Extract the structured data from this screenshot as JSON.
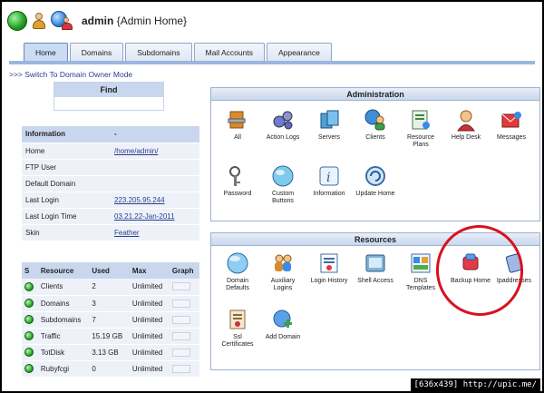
{
  "header": {
    "user": "admin",
    "context": "{Admin Home}"
  },
  "tabs": [
    {
      "label": "Home",
      "active": true
    },
    {
      "label": "Domains",
      "active": false
    },
    {
      "label": "Subdomains",
      "active": false
    },
    {
      "label": "Mail Accounts",
      "active": false
    },
    {
      "label": "Appearance",
      "active": false
    }
  ],
  "switch_link": ">>> Switch To Domain Owner Mode",
  "find": {
    "title": "Find",
    "value": ""
  },
  "information": {
    "header": "Information",
    "header_value": "-",
    "rows": [
      {
        "label": "Home",
        "value": "/home/admin/"
      },
      {
        "label": "FTP User",
        "value": ""
      },
      {
        "label": "Default Domain",
        "value": ""
      },
      {
        "label": "Last Login",
        "value": "223.205.95.244"
      },
      {
        "label": "Last Login Time",
        "value": "03.21.22-Jan-2011"
      },
      {
        "label": "Skin",
        "value": "Feather"
      }
    ]
  },
  "resources_table": {
    "headers": [
      "S",
      "Resource",
      "Used",
      "Max",
      "Graph"
    ],
    "rows": [
      {
        "resource": "Clients",
        "used": "2",
        "max": "Unlimited"
      },
      {
        "resource": "Domains",
        "used": "3",
        "max": "Unlimited"
      },
      {
        "resource": "Subdomains",
        "used": "7",
        "max": "Unlimited"
      },
      {
        "resource": "Traffic",
        "used": "15.19 GB",
        "max": "Unlimited"
      },
      {
        "resource": "TotDisk",
        "used": "3.13 GB",
        "max": "Unlimited"
      },
      {
        "resource": "Rubyfcgi",
        "used": "0",
        "max": "Unlimited"
      }
    ]
  },
  "administration": {
    "title": "Administration",
    "items": [
      {
        "label": "All",
        "icon": "tools-icon"
      },
      {
        "label": "Action Logs",
        "icon": "gears-icon"
      },
      {
        "label": "Servers",
        "icon": "servers-icon"
      },
      {
        "label": "Clients",
        "icon": "clients-icon"
      },
      {
        "label": "Resource Plans",
        "icon": "resource-plans-icon"
      },
      {
        "label": "Help Desk",
        "icon": "help-desk-icon"
      },
      {
        "label": "Messages",
        "icon": "messages-icon"
      },
      {
        "label": "Password",
        "icon": "key-icon"
      },
      {
        "label": "Custom Buttons",
        "icon": "custom-buttons-icon"
      },
      {
        "label": "Information",
        "icon": "information-icon"
      },
      {
        "label": "Update Home",
        "icon": "update-home-icon"
      }
    ]
  },
  "resources": {
    "title": "Resources",
    "items": [
      {
        "label": "Domain Defaults",
        "icon": "domain-defaults-icon"
      },
      {
        "label": "Auxiliary Logins",
        "icon": "auxiliary-logins-icon"
      },
      {
        "label": "Login History",
        "icon": "login-history-icon"
      },
      {
        "label": "Shell Access",
        "icon": "shell-access-icon"
      },
      {
        "label": "DNS Templates",
        "icon": "dns-templates-icon"
      },
      {
        "label": "Backup Home",
        "icon": "backup-home-icon"
      },
      {
        "label": "Ipaddresses",
        "icon": "ipaddresses-icon"
      },
      {
        "label": "Ssl Certificates",
        "icon": "ssl-certificates-icon"
      },
      {
        "label": "Add Domain",
        "icon": "add-domain-icon"
      }
    ]
  },
  "watermark": "[636x439] http://upic.me/",
  "colors": {
    "tab_line": "#9bb6de",
    "header_bg": "#c9d7ee",
    "row_bg": "#eef2f8",
    "highlight_circle": "#d8121c",
    "link": "#2a3d8f"
  }
}
